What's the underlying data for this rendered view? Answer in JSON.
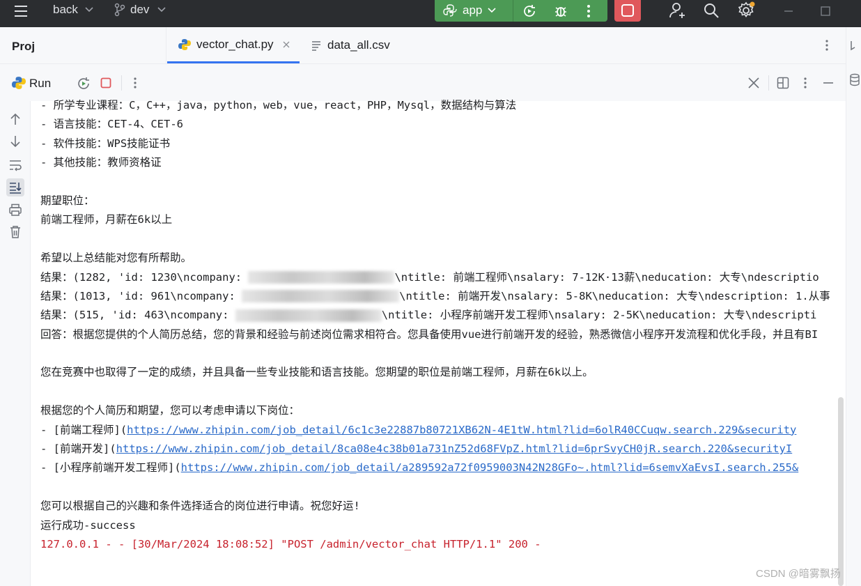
{
  "titlebar": {
    "project": "back",
    "branch": "dev",
    "run_config": "app"
  },
  "tabs": {
    "project_panel": "Proj",
    "items": [
      {
        "label": "vector_chat.py"
      },
      {
        "label": "data_all.csv"
      }
    ]
  },
  "run_panel": {
    "title": "Run"
  },
  "console": {
    "lines": [
      "- 所学专业课程：C，C++，java，python，web，vue，react，PHP，Mysql，数据结构与算法",
      "- 语言技能：CET-4、CET-6",
      "- 软件技能：WPS技能证书",
      "- 其他技能：教师资格证",
      "",
      "期望职位：",
      "前端工程师，月薪在6k以上",
      "",
      "希望以上总结能对您有所帮助。"
    ],
    "results": [
      {
        "prefix": "结果：(1282, 'id: 1230\\ncompany: ",
        "suffix": "\\ntitle: 前端工程师\\nsalary: 7-12K·13薪\\neducation: 大专\\ndescriptio"
      },
      {
        "prefix": "结果：(1013, 'id: 961\\ncompany: ",
        "suffix": "\\ntitle: 前端开发\\nsalary: 5-8K\\neducation: 大专\\ndescription: 1.从事"
      },
      {
        "prefix": "结果：(515, 'id: 463\\ncompany: ",
        "suffix": "\\ntitle: 小程序前端开发工程师\\nsalary: 2-5K\\neducation: 大专\\ndescripti"
      }
    ],
    "answer": "回答：根据您提供的个人简历总结，您的背景和经验与前述岗位需求相符合。您具备使用vue进行前端开发的经验，熟悉微信小程序开发流程和优化手段，并且有BI",
    "paragraph2": "您在竞赛中也取得了一定的成绩，并且具备一些专业技能和语言技能。您期望的职位是前端工程师，月薪在6k以上。",
    "paragraph3": "根据您的个人简历和期望，您可以考虑申请以下岗位：",
    "links": [
      {
        "prefix": "- [前端工程师](",
        "url": "https://www.zhipin.com/job_detail/6c1c3e22887b80721XB62N-4E1tW.html?lid=6olR40CCuqw.search.229&security"
      },
      {
        "prefix": "- [前端开发](",
        "url": "https://www.zhipin.com/job_detail/8ca08e4c38b01a731nZ52d68FVpZ.html?lid=6prSvyCH0jR.search.220&securityI"
      },
      {
        "prefix": "- [小程序前端开发工程师](",
        "url": "https://www.zhipin.com/job_detail/a289592a72f0959003N42N28GFo~.html?lid=6semvXaEvsI.search.255&"
      }
    ],
    "closing": "您可以根据自己的兴趣和条件选择适合的岗位进行申请。祝您好运!",
    "status": "运行成功-success",
    "log": "127.0.0.1 - - [30/Mar/2024 18:08:52] \"POST /admin/vector_chat HTTP/1.1\" 200 -"
  },
  "watermark": "CSDN @暗雾飘扬",
  "colors": {
    "titlebar_bg": "#2b2d30",
    "run_config_bg": "#4c9a55",
    "stop_bg": "#e0585c",
    "accent": "#3574f0",
    "link": "#2a6ac9",
    "log_error": "#c7222d"
  }
}
